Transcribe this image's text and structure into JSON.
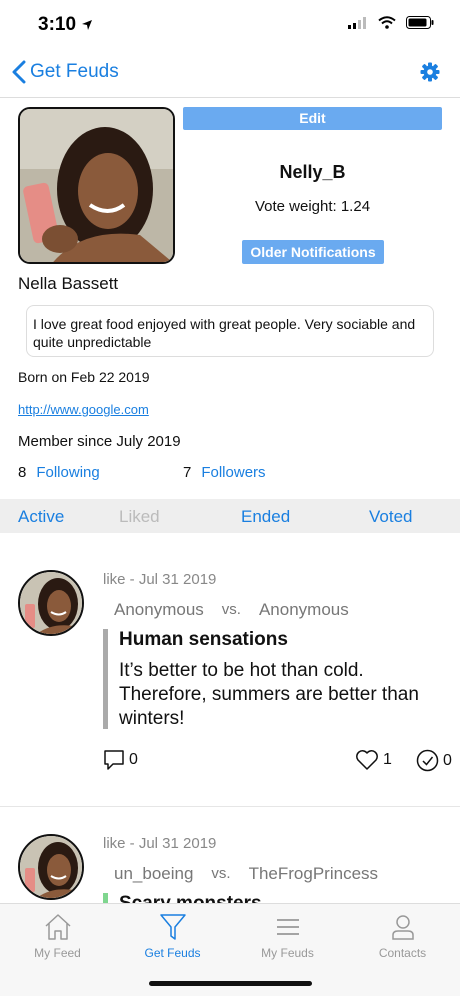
{
  "status_bar": {
    "time": "3:10"
  },
  "nav": {
    "back_label": "Get Feuds"
  },
  "profile": {
    "edit_label": "Edit",
    "username": "Nelly_B",
    "vote_weight": "Vote weight: 1.24",
    "older_notifications_label": "Older Notifications",
    "full_name": "Nella Bassett",
    "bio": "I love great food enjoyed with great people. Very sociable and quite unpredictable",
    "born": "Born on Feb 22 2019",
    "website": "http://www.google.com",
    "member_since": "Member since July 2019",
    "following_count": "8",
    "following_label": "Following",
    "followers_count": "7",
    "followers_label": "Followers"
  },
  "tabs": [
    {
      "label": "Active"
    },
    {
      "label": "Liked"
    },
    {
      "label": "Ended"
    },
    {
      "label": "Voted"
    }
  ],
  "feuds": [
    {
      "meta": "like - Jul 31 2019",
      "left_user": "Anonymous",
      "vs": "vs.",
      "right_user": "Anonymous",
      "title": "Human sensations",
      "text": "It’s better to be hot than cold. Therefore, summers are better than winters!",
      "comments": "0",
      "likes": "1",
      "votes": "0"
    },
    {
      "meta": "like - Jul 31 2019",
      "left_user": "un_boeing",
      "vs": "vs.",
      "right_user": "TheFrogPrincess",
      "title": "Scary monsters"
    }
  ],
  "tab_bar": [
    {
      "label": "My Feed",
      "icon": "home-icon"
    },
    {
      "label": "Get Feuds",
      "icon": "funnel-icon"
    },
    {
      "label": "My Feuds",
      "icon": "list-icon"
    },
    {
      "label": "Contacts",
      "icon": "person-icon"
    }
  ],
  "colors": {
    "accent": "#1a7fe0",
    "button": "#6aaaf0",
    "tab_bg": "#eeeeee"
  }
}
